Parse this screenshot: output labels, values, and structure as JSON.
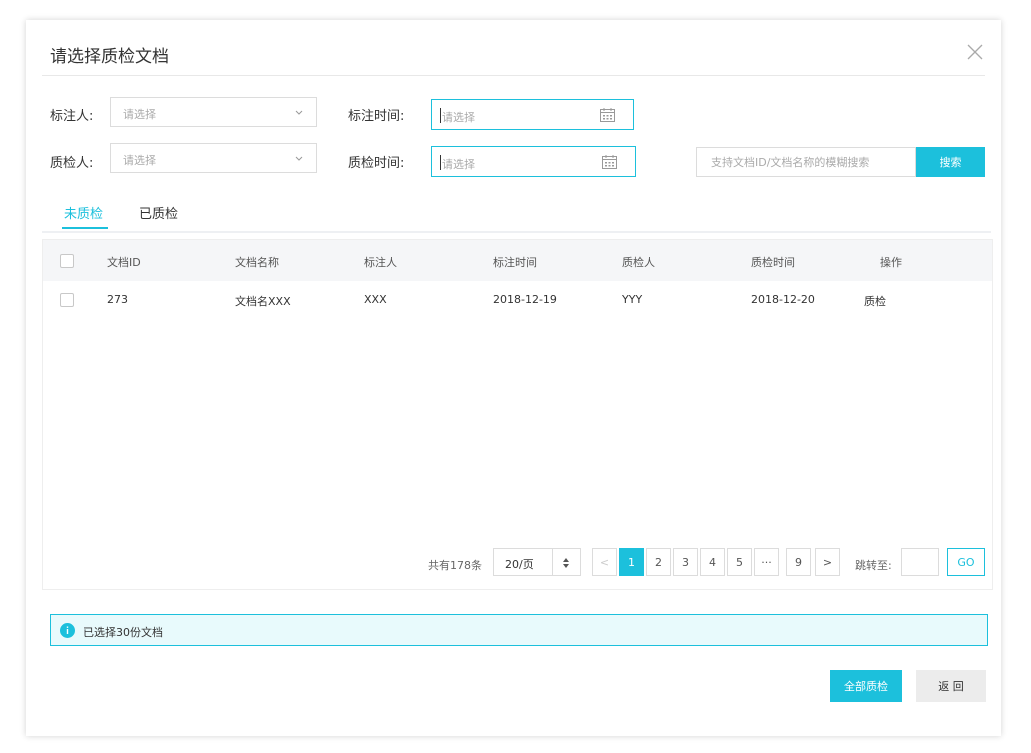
{
  "dialog": {
    "title": "请选择质检文档"
  },
  "filters": {
    "annotator_label": "标注人:",
    "annotator_placeholder": "请选择",
    "annotate_time_label": "标注时间:",
    "annotate_time_placeholder": "请选择",
    "inspector_label": "质检人:",
    "inspector_placeholder": "请选择",
    "inspect_time_label": "质检时间:",
    "inspect_time_placeholder": "请选择",
    "search_placeholder": "支持文档ID/文档名称的模糊搜索",
    "search_button": "搜索"
  },
  "tabs": [
    {
      "label": "未质检",
      "active": true
    },
    {
      "label": "已质检",
      "active": false
    }
  ],
  "table": {
    "columns": [
      "文档ID",
      "文档名称",
      "标注人",
      "标注时间",
      "质检人",
      "质检时间",
      "操作"
    ],
    "rows": [
      {
        "id": "273",
        "name": "文档名XXX",
        "annotator": "XXX",
        "annotate_time": "2018-12-19",
        "inspector": "YYY",
        "inspect_time": "2018-12-20",
        "action": "质检"
      }
    ]
  },
  "pagination": {
    "total_text": "共有178条",
    "page_size": "20/页",
    "prev": "<",
    "pages": [
      "1",
      "2",
      "3",
      "4",
      "5",
      "···",
      "9"
    ],
    "next": ">",
    "jump_label": "跳转至:",
    "go": "GO"
  },
  "notice": {
    "text": "已选择30份文档"
  },
  "footer": {
    "inspect_all": "全部质检",
    "back": "返 回"
  },
  "colors": {
    "accent": "#1cc0dc",
    "notice_bg": "#e8fafc"
  }
}
